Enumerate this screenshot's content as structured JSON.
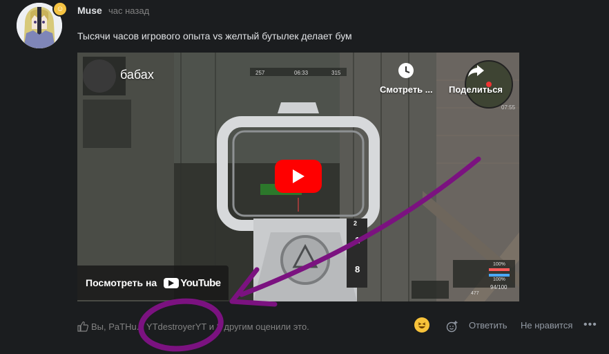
{
  "post": {
    "author": "Muse",
    "time": "час назад",
    "message": "Тысячи часов игрового опыта vs желтый бутылек делает бум"
  },
  "video": {
    "title": "бабах",
    "watch_later_label": "Смотреть ...",
    "share_label": "Поделиться",
    "watch_on_label": "Посмотреть на",
    "youtube_word": "YouTube",
    "hud": {
      "score_left": "257",
      "timer": "06:33",
      "score_right": "315",
      "clock": "07:55",
      "health": "100%",
      "armor": "100%",
      "ammo": "94/100",
      "money": "477",
      "weapon_slot_1": "1",
      "weapon_slot_2": "8",
      "weapon_slot_3": "2"
    }
  },
  "footer": {
    "likes_text": "Вы, PaTHu... YTdestroyerYT и 3 другим оценили это.",
    "reply_label": "Ответить",
    "dislike_label": "Не нравится",
    "more_label": "•••"
  },
  "colors": {
    "background": "#1b1d1f",
    "accent_red": "#ff0000",
    "annotation_purple": "#7b1280",
    "badge_yellow": "#f5c342"
  },
  "icons": {
    "badge": "flame-badge-icon",
    "watch_later": "clock-icon",
    "share": "share-arrow-icon",
    "play": "play-icon",
    "like": "thumbs-up-icon",
    "reaction": "laughing-emoji-icon",
    "add_reaction": "add-reaction-icon"
  }
}
